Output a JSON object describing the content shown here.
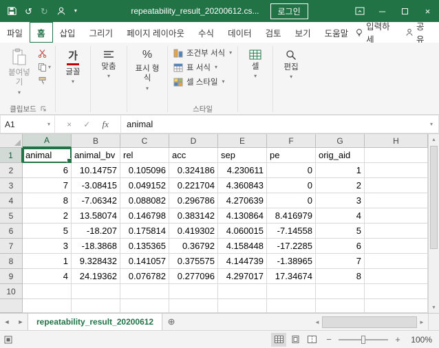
{
  "titlebar": {
    "title": "repeatability_result_20200612.cs...",
    "login": "로그인"
  },
  "tabs": {
    "items": [
      "파일",
      "홈",
      "삽입",
      "그리기",
      "페이지 레이아웃",
      "수식",
      "데이터",
      "검토",
      "보기",
      "도움말"
    ],
    "active": "홈",
    "tell_me": "입력하세",
    "share": "공유"
  },
  "ribbon": {
    "paste": "붙여넣기",
    "clipboard_group": "클립보드",
    "font_glyph": "가",
    "font_label": "글꼴",
    "align_label": "맞춤",
    "number_glyph": "%",
    "number_label": "표시 형식",
    "conditional_format": "조건부 서식",
    "format_as_table": "표 서식",
    "cell_styles": "셀 스타일",
    "styles_group": "스타일",
    "cells_label": "셀",
    "editing_label": "편집"
  },
  "formula_bar": {
    "name_box": "A1",
    "fx_label": "fx",
    "content": "animal"
  },
  "sheet": {
    "col_headers": [
      "A",
      "B",
      "C",
      "D",
      "E",
      "F",
      "G",
      "H"
    ],
    "row_headers": [
      "1",
      "2",
      "3",
      "4",
      "5",
      "6",
      "7",
      "8",
      "9",
      "10"
    ],
    "active_cell": "A1",
    "headers_row": [
      "animal",
      "animal_bv",
      "rel",
      "acc",
      "sep",
      "pe",
      "orig_aid"
    ],
    "data_rows": [
      [
        "6",
        "10.14757",
        "0.105096",
        "0.324186",
        "4.230611",
        "0",
        "1"
      ],
      [
        "7",
        "-3.08415",
        "0.049152",
        "0.221704",
        "4.360843",
        "0",
        "2"
      ],
      [
        "8",
        "-7.06342",
        "0.088082",
        "0.296786",
        "4.270639",
        "0",
        "3"
      ],
      [
        "2",
        "13.58074",
        "0.146798",
        "0.383142",
        "4.130864",
        "8.416979",
        "4"
      ],
      [
        "5",
        "-18.207",
        "0.175814",
        "0.419302",
        "4.060015",
        "-7.14558",
        "5"
      ],
      [
        "3",
        "-18.3868",
        "0.135365",
        "0.36792",
        "4.158448",
        "-17.2285",
        "6"
      ],
      [
        "1",
        "9.328432",
        "0.141057",
        "0.375575",
        "4.144739",
        "-1.38965",
        "7"
      ],
      [
        "4",
        "24.19362",
        "0.076782",
        "0.277096",
        "4.297017",
        "17.34674",
        "8"
      ]
    ]
  },
  "sheet_tabs": {
    "active": "repeatability_result_20200612"
  },
  "status_bar": {
    "zoom": "100%"
  },
  "icons": {
    "undo": "↺",
    "redo": "↻",
    "dropdown": "▾",
    "minimize": "─",
    "close": "×",
    "cancel": "×",
    "enter": "✓",
    "left": "◄",
    "right": "►",
    "up": "▲",
    "down": "▼",
    "new_sheet": "⊕",
    "zoom_out": "−",
    "zoom_in": "+"
  }
}
